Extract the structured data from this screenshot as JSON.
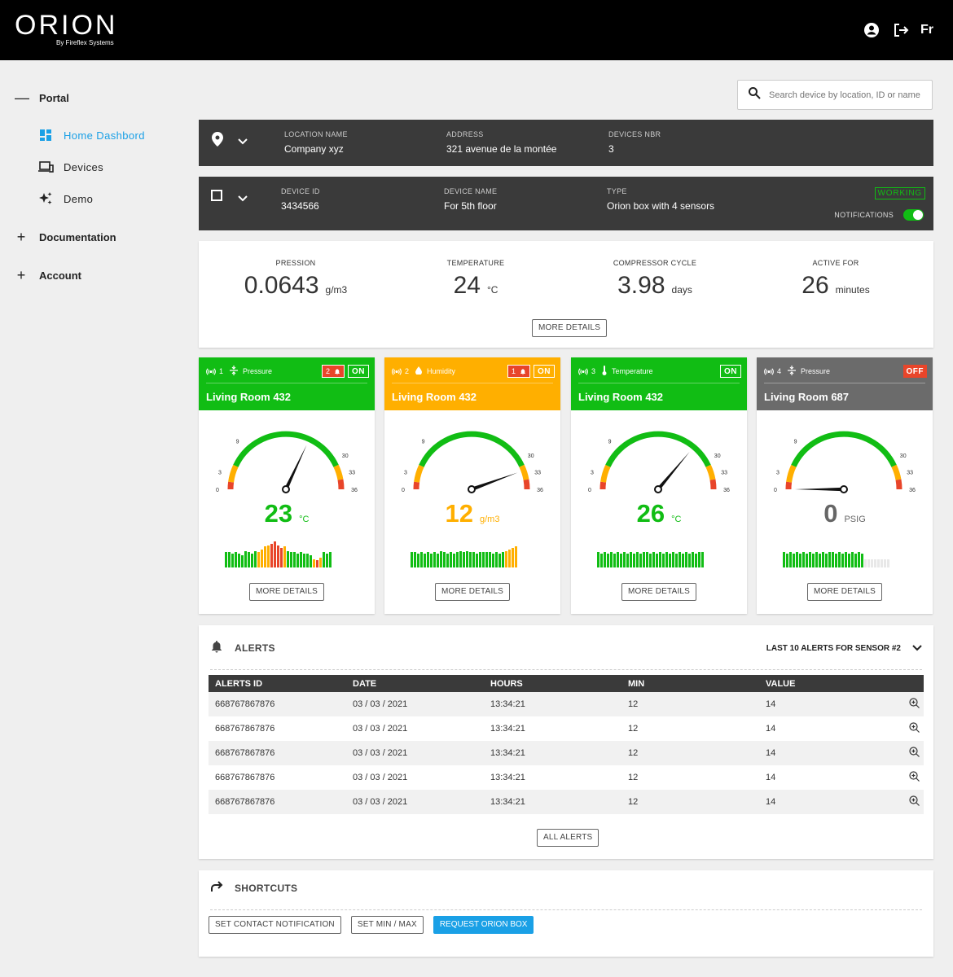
{
  "header": {
    "logo_title": "ORION",
    "logo_subtitle": "By Fireflex Systems",
    "lang": "Fr"
  },
  "sidebar": {
    "portal": "Portal",
    "items": [
      {
        "label": "Home Dashbord",
        "icon": "dashboard-icon",
        "active": true
      },
      {
        "label": "Devices",
        "icon": "devices-icon"
      },
      {
        "label": "Demo",
        "icon": "sparkle-icon"
      }
    ],
    "documentation": "Documentation",
    "account": "Account"
  },
  "search": {
    "placeholder": "Search device by location, ID or name"
  },
  "location": {
    "name_label": "LOCATION NAME",
    "name": "Company xyz",
    "address_label": "ADDRESS",
    "address": "321 avenue de la montée",
    "devices_label": "DEVICES NBR",
    "devices": "3"
  },
  "device": {
    "id_label": "DEVICE ID",
    "id": "3434566",
    "name_label": "DEVICE NAME",
    "name": "For 5th floor",
    "type_label": "TYPE",
    "type": "Orion box with 4 sensors",
    "status": "WORKING",
    "notifications_label": "NOTIFICATIONS",
    "notifications_on": true
  },
  "metrics": [
    {
      "label": "PRESSION",
      "value": "0.0643",
      "unit": "g/m3"
    },
    {
      "label": "TEMPERATURE",
      "value": "24",
      "unit": "°C"
    },
    {
      "label": "COMPRESSOR CYCLE",
      "value": "3.98",
      "unit": "days"
    },
    {
      "label": "ACTIVE FOR",
      "value": "26",
      "unit": "minutes"
    }
  ],
  "metrics_button": "MORE DETAILS",
  "gauge_ticks": [
    "0",
    "3",
    "9",
    "30",
    "33",
    "36"
  ],
  "sensors": [
    {
      "num": "1",
      "type": "Pressure",
      "alerts": "2",
      "state": "ON",
      "title": "Living Room 432",
      "value": "23",
      "unit": "°C",
      "reading": 23,
      "header_color": "#11bd14",
      "value_color": "#11bd14",
      "button": "MORE DETAILS",
      "bars": [
        0.55,
        0.55,
        0.5,
        0.55,
        0.5,
        0.45,
        0.6,
        0.55,
        0.5,
        0.6,
        0.55,
        0.65,
        0.75,
        0.8,
        0.85,
        0.95,
        0.8,
        0.7,
        0.75,
        0.6,
        0.55,
        0.55,
        0.5,
        0.55,
        0.5,
        0.5,
        0.45,
        0.3,
        0.25,
        0.35,
        0.55,
        0.5,
        0.55
      ],
      "bar_colors": [
        "g",
        "g",
        "g",
        "g",
        "g",
        "g",
        "g",
        "g",
        "g",
        "g",
        "o",
        "o",
        "o",
        "o",
        "r",
        "r",
        "r",
        "r",
        "o",
        "g",
        "g",
        "g",
        "g",
        "g",
        "g",
        "g",
        "g",
        "o",
        "r",
        "o",
        "g",
        "g",
        "g"
      ]
    },
    {
      "num": "2",
      "type": "Humidity",
      "alerts": "1",
      "state": "ON",
      "title": "Living Room 432",
      "value": "12",
      "unit": "g/m3",
      "reading": 32,
      "header_color": "#ffaf00",
      "value_color": "#ffaf00",
      "button": "MORE DETAILS",
      "bars": [
        0.55,
        0.55,
        0.5,
        0.55,
        0.5,
        0.55,
        0.5,
        0.55,
        0.5,
        0.6,
        0.55,
        0.5,
        0.55,
        0.5,
        0.55,
        0.6,
        0.55,
        0.6,
        0.55,
        0.55,
        0.5,
        0.55,
        0.55,
        0.55,
        0.55,
        0.5,
        0.55,
        0.5,
        0.55,
        0.6,
        0.65,
        0.7,
        0.75
      ],
      "bar_colors": [
        "g",
        "g",
        "g",
        "g",
        "g",
        "g",
        "g",
        "g",
        "g",
        "g",
        "g",
        "g",
        "g",
        "g",
        "g",
        "g",
        "g",
        "g",
        "g",
        "g",
        "g",
        "g",
        "g",
        "g",
        "g",
        "g",
        "g",
        "g",
        "g",
        "o",
        "o",
        "o",
        "o"
      ]
    },
    {
      "num": "3",
      "type": "Temperature",
      "state": "ON",
      "title": "Living Room 432",
      "value": "26",
      "unit": "°C",
      "reading": 26,
      "header_color": "#11bd14",
      "value_color": "#11bd14",
      "button": "MORE DETAILS",
      "bars": [
        0.55,
        0.5,
        0.55,
        0.5,
        0.55,
        0.5,
        0.55,
        0.5,
        0.55,
        0.5,
        0.55,
        0.5,
        0.55,
        0.5,
        0.55,
        0.55,
        0.5,
        0.55,
        0.5,
        0.55,
        0.5,
        0.55,
        0.5,
        0.55,
        0.5,
        0.55,
        0.5,
        0.55,
        0.5,
        0.55,
        0.5,
        0.55,
        0.55
      ],
      "bar_colors": [
        "g",
        "g",
        "g",
        "g",
        "g",
        "g",
        "g",
        "g",
        "g",
        "g",
        "g",
        "g",
        "g",
        "g",
        "g",
        "g",
        "g",
        "g",
        "g",
        "g",
        "g",
        "g",
        "g",
        "g",
        "g",
        "g",
        "g",
        "g",
        "g",
        "g",
        "g",
        "g",
        "g"
      ]
    },
    {
      "num": "4",
      "type": "Pressure",
      "state": "OFF",
      "title": "Living Room 687",
      "value": "0",
      "unit": "PSIG",
      "reading": 0,
      "header_color": "#6b6b6b",
      "value_color": "#666666",
      "button": "MORE DETAILS",
      "bars": [
        0.55,
        0.5,
        0.55,
        0.5,
        0.55,
        0.5,
        0.55,
        0.5,
        0.55,
        0.5,
        0.55,
        0.5,
        0.55,
        0.5,
        0.55,
        0.55,
        0.5,
        0.55,
        0.5,
        0.55,
        0.5,
        0.55,
        0.5,
        0.55,
        0.5,
        0.3,
        0.3,
        0.3,
        0.3,
        0.3,
        0.3,
        0.3,
        0.3
      ],
      "bar_colors": [
        "g",
        "g",
        "g",
        "g",
        "g",
        "g",
        "g",
        "g",
        "g",
        "g",
        "g",
        "g",
        "g",
        "g",
        "g",
        "g",
        "g",
        "g",
        "g",
        "g",
        "g",
        "g",
        "g",
        "g",
        "g",
        "x",
        "x",
        "x",
        "x",
        "x",
        "x",
        "x",
        "x"
      ]
    }
  ],
  "alerts": {
    "title": "ALERTS",
    "filter": "LAST 10 ALERTS FOR SENSOR #2",
    "columns": [
      "ALERTS ID",
      "DATE",
      "HOURS",
      "MIN",
      "VALUE"
    ],
    "rows": [
      [
        "668767867876",
        "03 / 03 / 2021",
        "13:34:21",
        "12",
        "14"
      ],
      [
        "668767867876",
        "03 / 03 / 2021",
        "13:34:21",
        "12",
        "14"
      ],
      [
        "668767867876",
        "03 / 03 / 2021",
        "13:34:21",
        "12",
        "14"
      ],
      [
        "668767867876",
        "03 / 03 / 2021",
        "13:34:21",
        "12",
        "14"
      ],
      [
        "668767867876",
        "03 / 03 / 2021",
        "13:34:21",
        "12",
        "14"
      ]
    ],
    "all_button": "ALL ALERTS"
  },
  "shortcuts": {
    "title": "SHORTCUTS",
    "buttons": [
      "SET CONTACT NOTIFICATION",
      "SET MIN / MAX",
      "REQUEST ORION BOX"
    ]
  },
  "colors": {
    "accent": "#1aa0e6",
    "green": "#11bd14",
    "orange": "#ffaf00",
    "red": "#e8452a",
    "dark": "#3a3a3a"
  }
}
